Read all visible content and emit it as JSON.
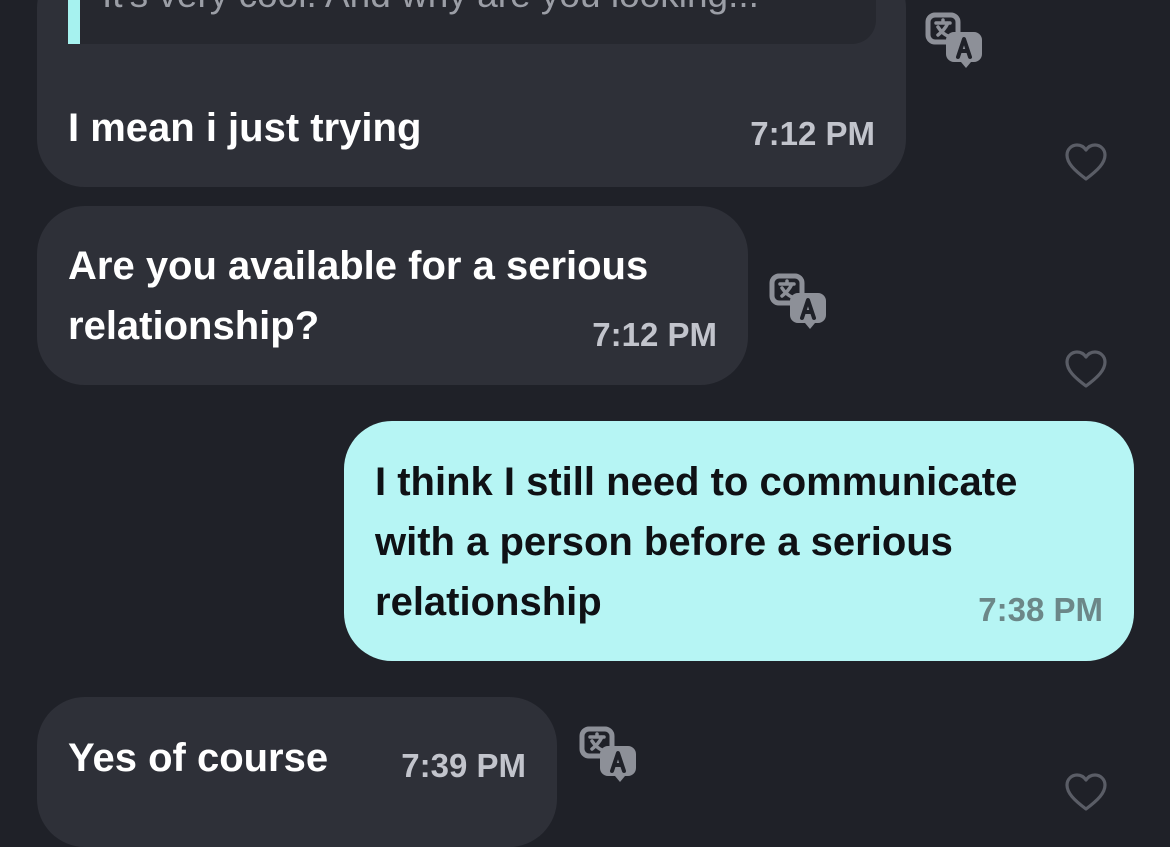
{
  "messages": [
    {
      "direction": "incoming",
      "quote": "It's very cool. And why are you looking...",
      "text": "I mean i just trying",
      "time": "7:12 PM"
    },
    {
      "direction": "incoming",
      "lines": [
        "Are you available for a serious",
        "relationship?"
      ],
      "time": "7:12 PM"
    },
    {
      "direction": "outgoing",
      "lines": [
        "I think I still need to communicate",
        "with a person before a serious",
        "relationship"
      ],
      "time": "7:38 PM"
    },
    {
      "direction": "incoming",
      "text": "Yes of course",
      "time": "7:39 PM"
    }
  ],
  "icons": {
    "translate": "translate-icon",
    "like": "heart-icon"
  },
  "colors": {
    "background": "#1f2128",
    "incoming_bubble": "#2e3038",
    "outgoing_bubble": "#b6f5f4",
    "quote_accent": "#a6f2ef",
    "icon": "#8d9098"
  }
}
